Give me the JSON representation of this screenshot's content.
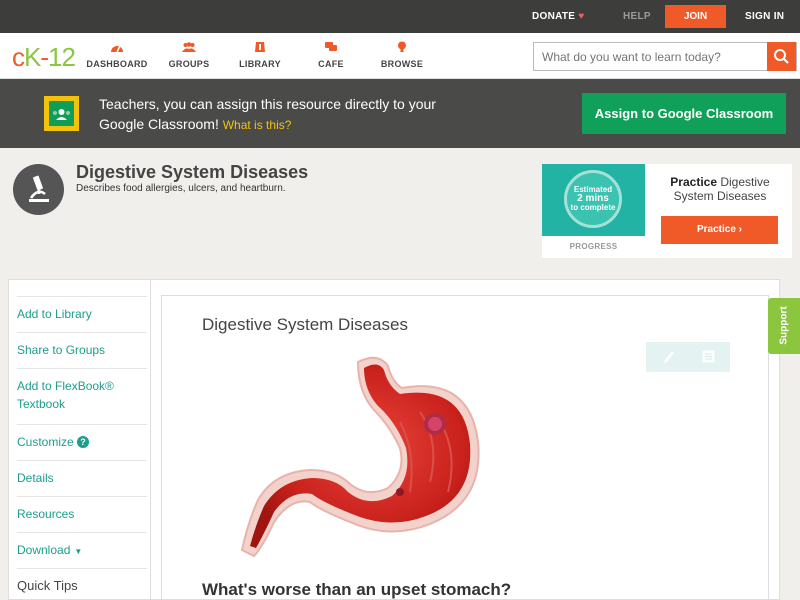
{
  "topbar": {
    "donate": "DONATE",
    "help": "HELP",
    "join": "JOIN",
    "sign_in": "SIGN IN"
  },
  "logo": {
    "c": "c",
    "k": "K",
    "dash": "-",
    "num": "12"
  },
  "nav": {
    "items": [
      {
        "label": "DASHBOARD",
        "icon": "dashboard-icon"
      },
      {
        "label": "GROUPS",
        "icon": "groups-icon"
      },
      {
        "label": "LIBRARY",
        "icon": "library-icon"
      },
      {
        "label": "CAFE",
        "icon": "cafe-icon"
      },
      {
        "label": "BROWSE",
        "icon": "browse-icon"
      }
    ],
    "search_placeholder": "What do you want to learn today?"
  },
  "banner": {
    "text": "Teachers, you can assign this resource directly to your Google Classroom!",
    "what_link": "What is this?",
    "assign_button": "Assign to Google Classroom"
  },
  "header": {
    "title": "Digestive System Diseases",
    "description": "Describes food allergies, ulcers, and heartburn."
  },
  "practice": {
    "estimated_line1": "Estimated",
    "estimated_line2": "2 mins",
    "estimated_line3": "to complete",
    "progress_label": "PROGRESS",
    "title_bold": "Practice",
    "title_rest": "Digestive System Diseases",
    "button": "Practice"
  },
  "sidebar": {
    "items": [
      {
        "label": "Add to Library"
      },
      {
        "label": "Share to Groups"
      },
      {
        "label": "Add to FlexBook® Textbook"
      },
      {
        "label": "Customize"
      },
      {
        "label": "Details"
      },
      {
        "label": "Resources"
      },
      {
        "label": "Download"
      }
    ],
    "quick_tips": "Quick Tips"
  },
  "content": {
    "title": "Digestive System Diseases",
    "question": "What's worse than an upset stomach?"
  },
  "support": "Support",
  "colors": {
    "accent_orange": "#f05a28",
    "brand_green": "#8cc63f",
    "teal_link": "#1d9e8c",
    "classroom_green": "#11a05a"
  }
}
